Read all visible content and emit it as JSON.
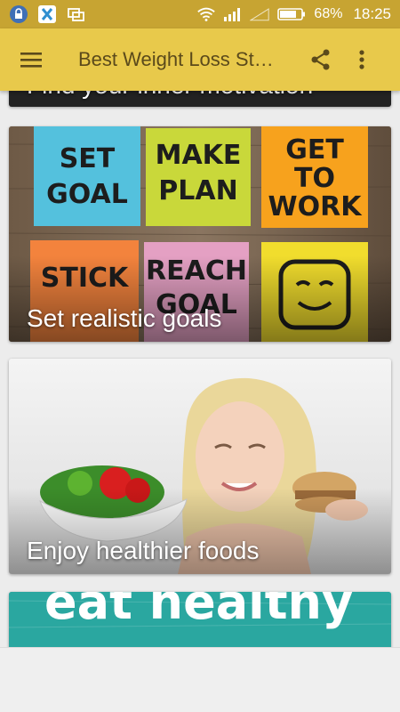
{
  "status_bar": {
    "battery": "68%",
    "time": "18:25"
  },
  "toolbar": {
    "title": "Best Weight Loss St…"
  },
  "cards": [
    {
      "caption": "Find your inner motivation"
    },
    {
      "caption": "Set realistic goals",
      "notes": [
        "SET GOAL",
        "MAKE PLAN",
        "GET TO WORK",
        "STICK TO IT",
        "REACH GOAL"
      ]
    },
    {
      "caption": "Enjoy healthier foods"
    },
    {
      "caption": "eat healthy"
    }
  ],
  "colors": {
    "status_bar": "#c7a432",
    "toolbar": "#e8c94b",
    "background": "#ececec"
  }
}
